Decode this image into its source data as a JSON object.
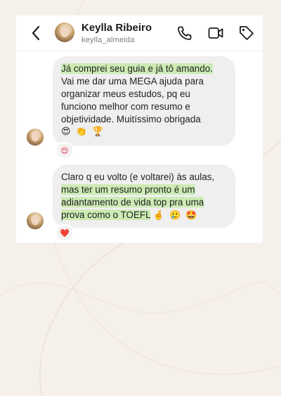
{
  "header": {
    "name": "Keylla Ribeiro",
    "handle": "keylla_almeida",
    "icons": [
      "back-arrow-icon",
      "phone-icon",
      "video-camera-icon",
      "tag-icon"
    ]
  },
  "messages": [
    {
      "highlight": "Já comprei seu guia e já tô amando.",
      "text": "Vai me dar uma MEGA ajuda para organizar meus estudos, pq eu funciono melhor com resumo e objetividade. Muitíssimo obrigada",
      "emojis": [
        "😍",
        "👏",
        "🏆"
      ],
      "reaction": "😍"
    },
    {
      "text": "Claro q eu volto (e voltarei) às aulas,",
      "highlight": "mas ter um resumo pronto é um adiantamento de vida top pra uma prova como o TOEFL",
      "emojis": [
        "🤞",
        "🥲",
        "🤩"
      ],
      "reaction": "❤️"
    }
  ],
  "colors": {
    "background": "#f5f0e9",
    "highlight": "#ccebb4",
    "bubble": "#efefef"
  }
}
